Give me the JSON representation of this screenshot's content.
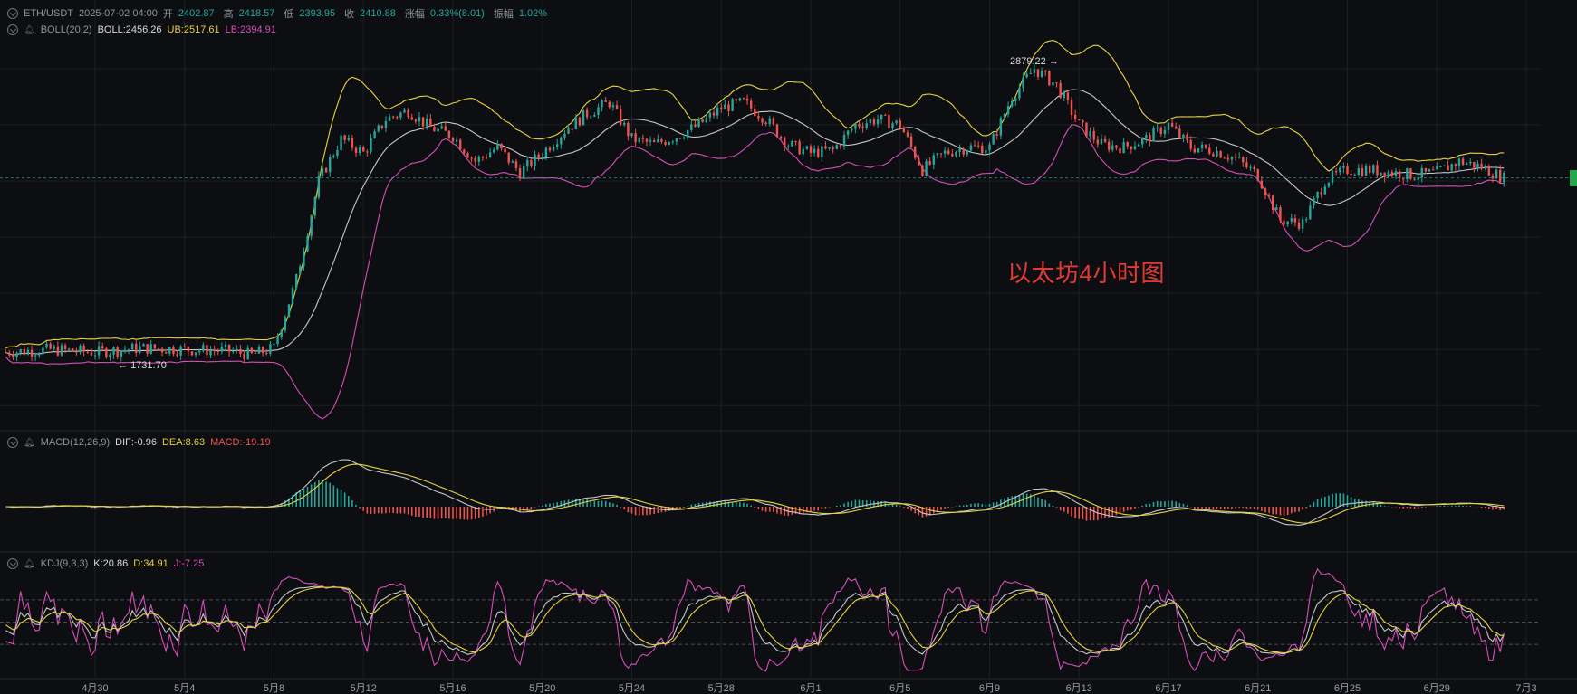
{
  "header": {
    "symbol": "ETH/USDT",
    "datetime": "2025-07-02 04:00",
    "open_label": "开",
    "open": "2402.87",
    "high_label": "高",
    "high": "2418.57",
    "low_label": "低",
    "low": "2393.95",
    "close_label": "收",
    "close": "2410.88",
    "change_label": "涨幅",
    "change": "0.33%(8.01)",
    "amp_label": "振幅",
    "amp": "1.02%"
  },
  "boll": {
    "name": "BOLL(20,2)",
    "mid": "BOLL:2456.26",
    "ub": "UB:2517.61",
    "lb": "LB:2394.91"
  },
  "macd": {
    "name": "MACD(12,26,9)",
    "dif": "DIF:-0.96",
    "dea": "DEA:8.63",
    "hist": "MACD:-19.19"
  },
  "kdj": {
    "name": "KDJ(9,3,3)",
    "k": "K:20.86",
    "d": "D:34.91",
    "j": "J:-7.25"
  },
  "annotations": {
    "high_marker": "2879.22",
    "low_marker": "1731.70",
    "watermark": "以太坊4小时图"
  },
  "colors": {
    "up": "#26a69a",
    "down": "#ef5350",
    "ub": "#e8d33f",
    "lb": "#d64fb8",
    "mid": "#c8c8c8",
    "dif": "#c8c8c8",
    "dea": "#e8d33f",
    "k": "#c8c8c8",
    "d": "#e8d33f",
    "j": "#d64fb8",
    "background": "#0d0e11",
    "grid": "#1c1e23",
    "text": "#9aa0a8"
  },
  "chart_data": [
    {
      "type": "candlestick",
      "title": "ETH/USDT",
      "xlabel": "",
      "ylabel": "",
      "x_ticks": [
        "4月30",
        "5月4",
        "5月8",
        "5月12",
        "5月16",
        "5月20",
        "5月24",
        "5月28",
        "6月1",
        "6月5",
        "6月9",
        "6月13",
        "6月17",
        "6月21",
        "6月25",
        "6月29",
        "7月3"
      ],
      "ylim": [
        1530,
        2980
      ],
      "grid": true,
      "close_path": [
        [
          "4月26",
          1790
        ],
        [
          "4月28",
          1800
        ],
        [
          "4月30",
          1790
        ],
        [
          "5月2",
          1805
        ],
        [
          "5月4",
          1800
        ],
        [
          "5月6",
          1795
        ],
        [
          "5月7",
          1780
        ],
        [
          "5月8",
          1805
        ],
        [
          "5月9",
          2050
        ],
        [
          "5月10",
          2400
        ],
        [
          "5月11",
          2550
        ],
        [
          "5月12",
          2500
        ],
        [
          "5月13",
          2620
        ],
        [
          "5月14",
          2650
        ],
        [
          "5月15",
          2590
        ],
        [
          "5月16",
          2560
        ],
        [
          "5月17",
          2470
        ],
        [
          "5月18",
          2520
        ],
        [
          "5月19",
          2430
        ],
        [
          "5月20",
          2500
        ],
        [
          "5月21",
          2580
        ],
        [
          "5月22",
          2640
        ],
        [
          "5月23",
          2680
        ],
        [
          "5月24",
          2550
        ],
        [
          "5月25",
          2530
        ],
        [
          "5月26",
          2560
        ],
        [
          "5月27",
          2600
        ],
        [
          "5月28",
          2660
        ],
        [
          "5月29",
          2680
        ],
        [
          "5月30",
          2620
        ],
        [
          "5月31",
          2530
        ],
        [
          "6月1",
          2500
        ],
        [
          "6月2",
          2510
        ],
        [
          "6月3",
          2600
        ],
        [
          "6月4",
          2620
        ],
        [
          "6月5",
          2600
        ],
        [
          "6月6",
          2440
        ],
        [
          "6月7",
          2500
        ],
        [
          "6月8",
          2520
        ],
        [
          "6月9",
          2520
        ],
        [
          "6月10",
          2700
        ],
        [
          "6月11",
          2800
        ],
        [
          "6月12",
          2740
        ],
        [
          "6月13",
          2600
        ],
        [
          "6月14",
          2530
        ],
        [
          "6月15",
          2520
        ],
        [
          "6月16",
          2550
        ],
        [
          "6月17",
          2600
        ],
        [
          "6月18",
          2520
        ],
        [
          "6月19",
          2510
        ],
        [
          "6月20",
          2480
        ],
        [
          "6月21",
          2420
        ],
        [
          "6月22",
          2260
        ],
        [
          "6月23",
          2250
        ],
        [
          "6月24",
          2400
        ],
        [
          "6月25",
          2440
        ],
        [
          "6月26",
          2440
        ],
        [
          "6月27",
          2430
        ],
        [
          "6月28",
          2420
        ],
        [
          "6月29",
          2430
        ],
        [
          "6月30",
          2470
        ],
        [
          "7月1",
          2450
        ],
        [
          "7月2",
          2410
        ]
      ],
      "series": [
        {
          "name": "BOLL",
          "value": 2456.26
        },
        {
          "name": "UB",
          "value": 2517.61
        },
        {
          "name": "LB",
          "value": 2394.91
        }
      ],
      "annotations": [
        {
          "text": "2879.22",
          "x": "6月12",
          "y": 2879.22
        },
        {
          "text": "1731.70",
          "x": "5月1",
          "y": 1731.7
        }
      ]
    },
    {
      "type": "bar",
      "title": "MACD(12,26,9)",
      "series": [
        {
          "name": "DIF",
          "value": -0.96
        },
        {
          "name": "DEA",
          "value": 8.63
        },
        {
          "name": "MACD",
          "value": -19.19
        }
      ]
    },
    {
      "type": "line",
      "title": "KDJ(9,3,3)",
      "ylim": [
        -20,
        120
      ],
      "reference_lines": [
        20,
        50,
        80
      ],
      "series": [
        {
          "name": "K",
          "value": 20.86
        },
        {
          "name": "D",
          "value": 34.91
        },
        {
          "name": "J",
          "value": -7.25
        }
      ]
    }
  ]
}
